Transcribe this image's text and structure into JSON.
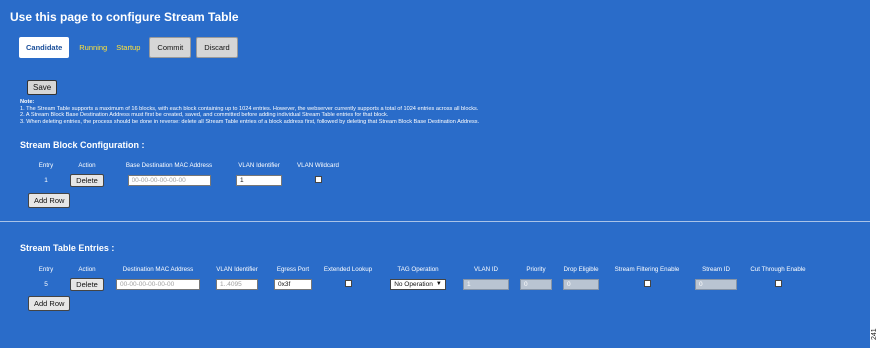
{
  "page": {
    "title": "Use this page to configure Stream Table",
    "figure_number": "241"
  },
  "tabs": [
    {
      "label": "Candidate",
      "active": true
    },
    {
      "label": "Running",
      "active": false
    },
    {
      "label": "Startup",
      "active": false
    }
  ],
  "actions": {
    "commit": "Commit",
    "discard": "Discard",
    "save": "Save"
  },
  "notes": {
    "heading": "Note:",
    "lines": [
      "1. The Stream Table supports a maximum of 16 blocks, with each block containing up to 1024 entries. However, the webserver currently supports a total of 1024 entries across all blocks.",
      "2. A Stream Block Base Destination Address must first be created, saved, and committed before adding individual Stream Table entries for that block.",
      "3. When deleting entries, the process should be done in reverse: delete all Stream Table entries of a block address first, followed by deleting that Stream Block Base Destination Address."
    ]
  },
  "block_config": {
    "title": "Stream Block Configuration :",
    "columns": [
      "Entry",
      "Action",
      "Base Destination MAC Address",
      "VLAN Identifier",
      "VLAN Wildcard"
    ],
    "row": {
      "entry": "1",
      "action": "Delete",
      "mac_placeholder": "00-00-00-00-00-00",
      "vlan_id": "1",
      "vlan_wildcard": false
    },
    "add_row": "Add Row"
  },
  "stream_entries": {
    "title": "Stream Table Entries :",
    "columns": [
      "Entry",
      "Action",
      "Destination MAC Address",
      "VLAN Identifier",
      "Egress Port",
      "Extended Lookup",
      "TAG Operation",
      "VLAN ID",
      "Priority",
      "Drop Eligible",
      "Stream Filtering Enable",
      "Stream ID",
      "Cut Through Enable"
    ],
    "row": {
      "entry": "5",
      "action": "Delete",
      "mac_placeholder": "00-00-00-00-00-00",
      "vlan_placeholder": "1..4095",
      "egress_port": "0x3f",
      "extended_lookup": false,
      "tag_operation": "No Operation",
      "vlan_id": "1",
      "priority": "0",
      "drop_eligible": "0",
      "stream_filtering_enable": false,
      "stream_id": "0",
      "cut_through_enable": false
    },
    "add_row": "Add Row"
  },
  "colors": {
    "panel_background": "#2a6cc9",
    "tab_link": "#ffe23a",
    "active_tab_text": "#1b4f9a"
  }
}
